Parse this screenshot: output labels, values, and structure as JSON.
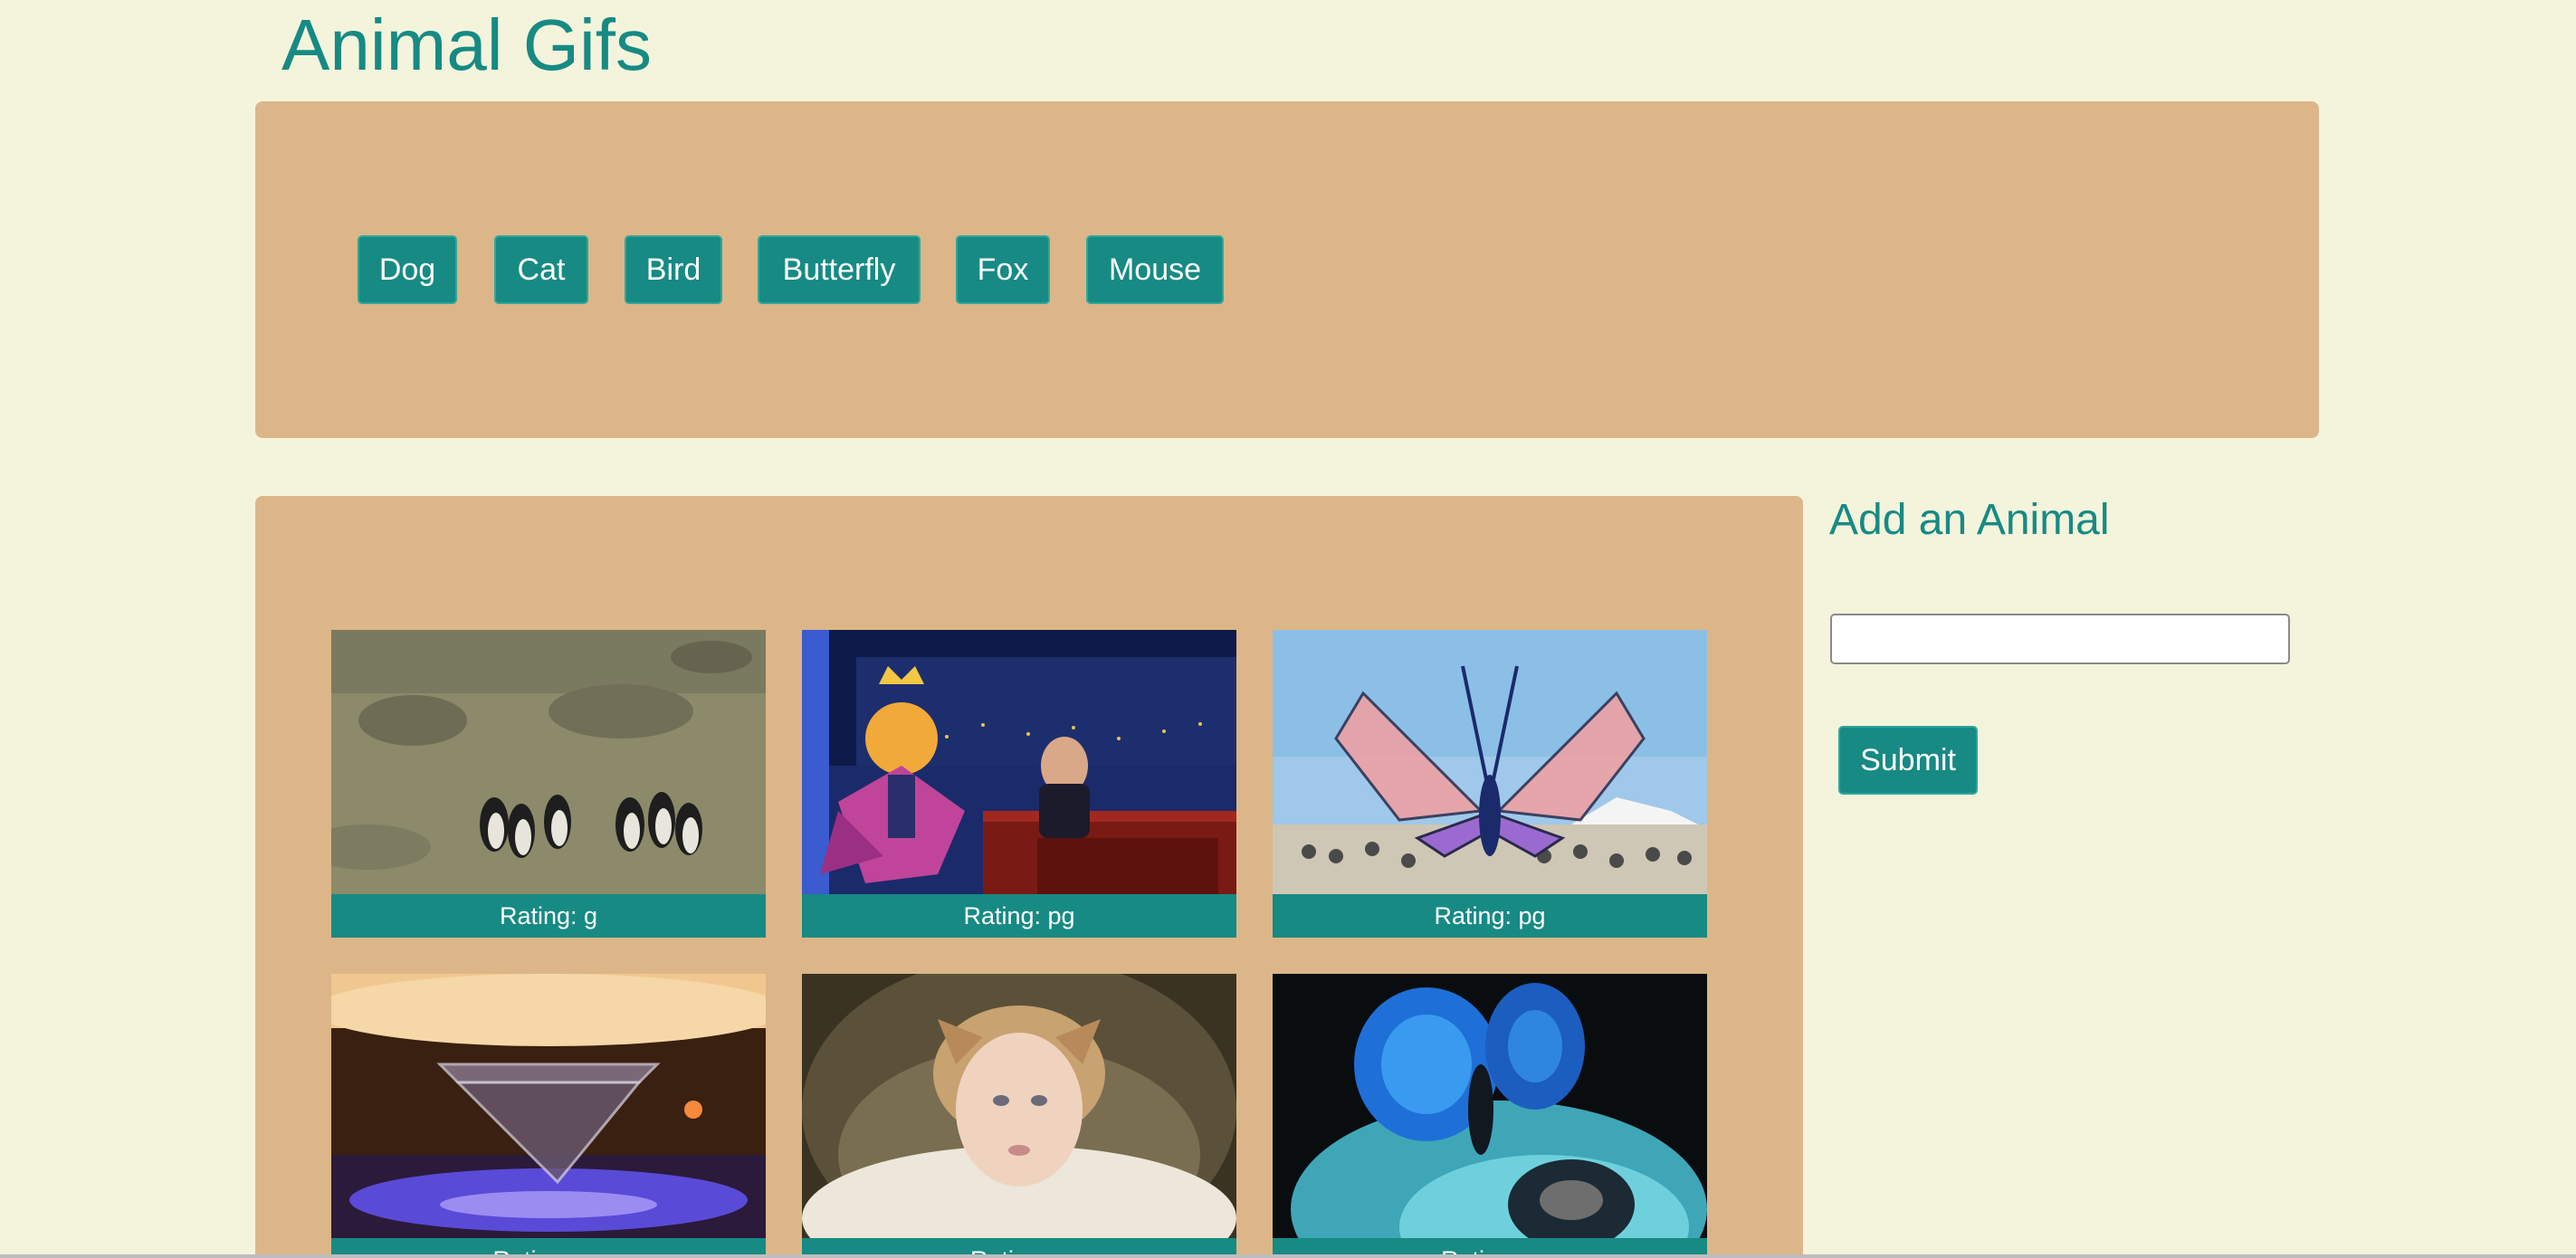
{
  "page": {
    "title": "Animal Gifs"
  },
  "animal_buttons": [
    {
      "label": "Dog"
    },
    {
      "label": "Cat"
    },
    {
      "label": "Bird"
    },
    {
      "label": "Butterfly"
    },
    {
      "label": "Fox"
    },
    {
      "label": "Mouse"
    }
  ],
  "gifs": [
    {
      "rating": "Rating: g",
      "subject": "penguins walking on rocky ground"
    },
    {
      "rating": "Rating: pg",
      "subject": "cartoon bird with crown at talk show desk"
    },
    {
      "rating": "Rating: pg",
      "subject": "giant butterfly sculpture over crowd"
    },
    {
      "rating": "Rating: pg",
      "subject": "glass prism on glowing surface"
    },
    {
      "rating": "Rating: g",
      "subject": "woman with butterfly in hair"
    },
    {
      "rating": "Rating: g",
      "subject": "blue morpho butterfly close-up"
    }
  ],
  "side_form": {
    "title": "Add an Animal",
    "input_value": "",
    "input_placeholder": "",
    "submit_label": "Submit"
  },
  "colors": {
    "background": "#f4f4dc",
    "panel": "#dcb688",
    "accent": "#178a84"
  }
}
